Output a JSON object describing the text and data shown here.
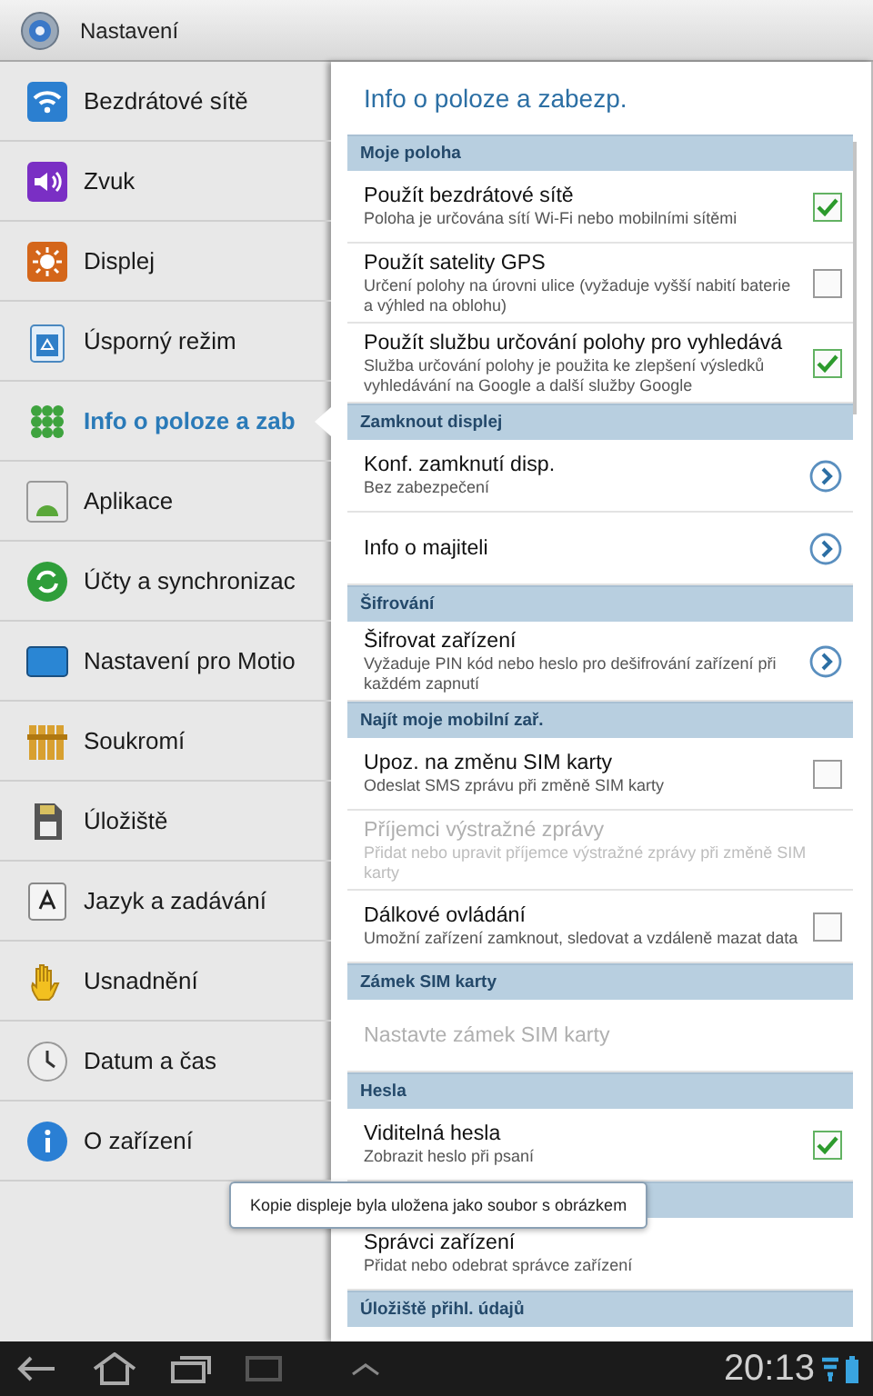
{
  "app_bar": {
    "title": "Nastavení"
  },
  "sidebar": {
    "items": [
      {
        "label": "Bezdrátové sítě",
        "selected": false
      },
      {
        "label": "Zvuk",
        "selected": false
      },
      {
        "label": "Displej",
        "selected": false
      },
      {
        "label": "Úsporný režim",
        "selected": false
      },
      {
        "label": "Info o poloze a zab",
        "selected": true
      },
      {
        "label": "Aplikace",
        "selected": false
      },
      {
        "label": "Účty a synchronizac",
        "selected": false
      },
      {
        "label": "Nastavení pro Motio",
        "selected": false
      },
      {
        "label": "Soukromí",
        "selected": false
      },
      {
        "label": "Úložiště",
        "selected": false
      },
      {
        "label": "Jazyk a zadávání",
        "selected": false
      },
      {
        "label": "Usnadnění",
        "selected": false
      },
      {
        "label": "Datum a čas",
        "selected": false
      },
      {
        "label": "O zařízení",
        "selected": false
      }
    ]
  },
  "panel": {
    "title": "Info o poloze a zabezp.",
    "sections": [
      {
        "title": "Moje poloha",
        "items": [
          {
            "kind": "checkbox",
            "title": "Použít bezdrátové sítě",
            "summary": "Poloha je určována sítí Wi-Fi nebo mobilními sítěmi",
            "checked": true,
            "disabled": false
          },
          {
            "kind": "checkbox",
            "title": "Použít satelity GPS",
            "summary": "Určení polohy na úrovni ulice (vyžaduje vyšší nabití baterie a výhled na oblohu)",
            "checked": false,
            "disabled": false
          },
          {
            "kind": "checkbox",
            "title": "Použít službu určování polohy pro vyhledává",
            "summary": "Služba určování polohy je použita ke zlepšení výsledků vyhledávání na Google a další služby Google",
            "checked": true,
            "disabled": false
          }
        ]
      },
      {
        "title": "Zamknout displej",
        "items": [
          {
            "kind": "arrow",
            "title": "Konf. zamknutí disp.",
            "summary": "Bez zabezpečení",
            "disabled": false
          },
          {
            "kind": "arrow",
            "title": "Info o majiteli",
            "disabled": false
          }
        ]
      },
      {
        "title": "Šifrování",
        "items": [
          {
            "kind": "arrow",
            "title": "Šifrovat zařízení",
            "summary": "Vyžaduje PIN kód nebo heslo pro dešifrování zařízení při každém zapnutí",
            "disabled": false
          }
        ]
      },
      {
        "title": "Najít moje mobilní zař.",
        "items": [
          {
            "kind": "checkbox",
            "title": "Upoz. na změnu SIM karty",
            "summary": "Odeslat SMS zprávu při změně SIM karty",
            "checked": false,
            "disabled": false
          },
          {
            "kind": "plain",
            "title": "Příjemci výstražné zprávy",
            "summary": "Přidat nebo upravit příjemce výstražné zprávy při změně SIM karty",
            "disabled": true
          },
          {
            "kind": "checkbox",
            "title": "Dálkové ovládání",
            "summary": "Umožní zařízení zamknout, sledovat a vzdáleně mazat data",
            "checked": false,
            "disabled": false
          }
        ]
      },
      {
        "title": "Zámek SIM karty",
        "items": [
          {
            "kind": "plain",
            "title": "Nastavte zámek SIM karty",
            "disabled": true
          }
        ]
      },
      {
        "title": "Hesla",
        "items": [
          {
            "kind": "checkbox",
            "title": "Viditelná hesla",
            "summary": "Zobrazit heslo při psaní",
            "checked": true,
            "disabled": false
          }
        ]
      },
      {
        "items": [
          {
            "kind": "plain",
            "title": "Správci zařízení",
            "summary": "Přidat nebo odebrat správce zařízení",
            "disabled": false
          }
        ]
      },
      {
        "title": "Úložiště přihl. údajů"
      }
    ]
  },
  "toast": "Kopie displeje byla uložena jako soubor s obrázkem",
  "system_bar": {
    "time": "20:13"
  }
}
